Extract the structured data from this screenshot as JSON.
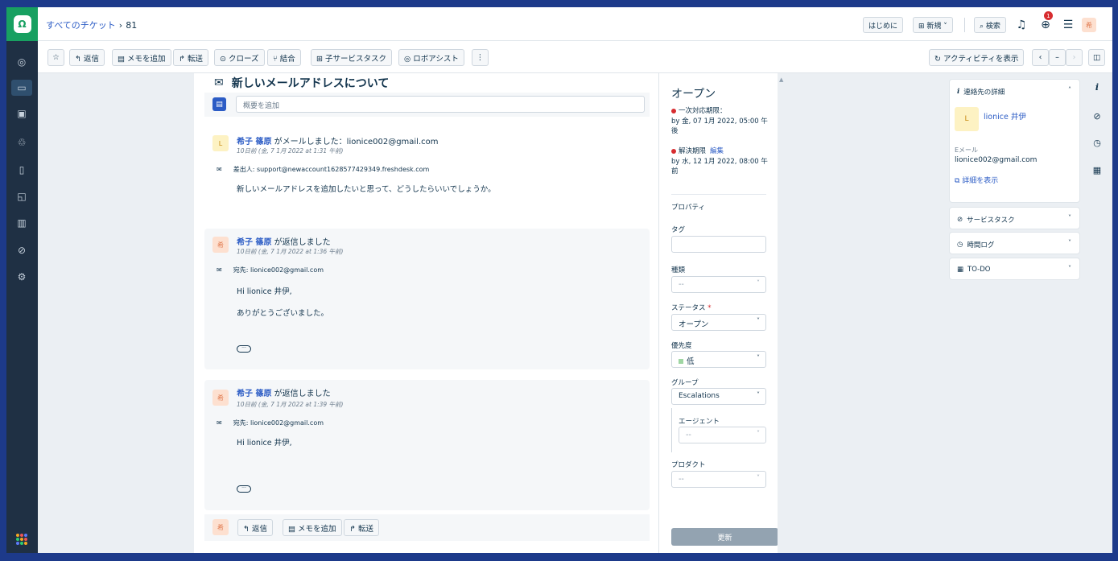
{
  "nav": {
    "logo": "Ω",
    "icons": [
      {
        "name": "dashboard-icon",
        "glyph": "◎"
      },
      {
        "name": "tickets-icon",
        "glyph": "▭"
      },
      {
        "name": "contacts-icon",
        "glyph": "▣"
      },
      {
        "name": "assets-icon",
        "glyph": "♲"
      },
      {
        "name": "knowledge-base-icon",
        "glyph": "▯"
      },
      {
        "name": "problems-icon",
        "glyph": "◱"
      },
      {
        "name": "reports-icon",
        "glyph": "▥"
      },
      {
        "name": "service-tasks-icon",
        "glyph": "⊘"
      },
      {
        "name": "settings-icon",
        "glyph": "⚙"
      }
    ]
  },
  "header": {
    "breadcrumb_link": "すべてのチケット",
    "breadcrumb_sep": "›",
    "ticket_id": "81",
    "getting_started": "はじめに",
    "new_button": "⊞ 新規 ˅",
    "search": "⌕ 検索",
    "notification_glyph": "♫",
    "gift_glyph": "⊕",
    "badge_count": "1",
    "headset_glyph": "☰",
    "avatar": "希"
  },
  "toolbar": {
    "star": "☆",
    "reply": "↰ 返信",
    "add_note": "▤ メモを追加",
    "forward": "↱ 転送",
    "close": "⊙ クローズ",
    "merge": "⑂ 結合",
    "child_task": "⊞ 子サービスタスク",
    "robo_assist": "◎ ロボアシスト",
    "more": "⋮",
    "show_activity": "↻ アクティビティを表示",
    "prev": "‹",
    "minus": "–",
    "next": "›",
    "panel_toggle": "◫"
  },
  "ticket": {
    "subject": "新しいメールアドレスについて",
    "summary_placeholder": "概要を追加"
  },
  "messages": [
    {
      "avatar": "L",
      "author": "希子 篠原",
      "action": " がメールしました：lionice002@gmail.com",
      "time": "10日前 (金, 7 1月 2022 at 1:31 午前)",
      "meta": "差出人: support@newaccount1628577429349.freshdesk.com",
      "body": "新しいメールアドレスを追加したいと思って、どうしたらいいでしょうか。"
    },
    {
      "avatar": "希",
      "author": "希子 篠原",
      "action": " が返信しました",
      "time": "10日前 (金, 7 1月 2022 at 1:36 午前)",
      "meta": "宛先: lionice002@gmail.com",
      "body": "Hi lionice 井伊,",
      "body2": "ありがとうございました。"
    },
    {
      "avatar": "希",
      "author": "希子 篠原",
      "action": " が返信しました",
      "time": "10日前 (金, 7 1月 2022 at 1:39 午前)",
      "meta": "宛先: lionice002@gmail.com",
      "body": "Hi lionice 井伊,"
    }
  ],
  "bottom": {
    "avatar": "希",
    "reply": "↰ 返信",
    "add_note": "▤ メモを追加",
    "forward": "↱ 転送"
  },
  "properties": {
    "status_title": "オープン",
    "first_response_label": "一次対応期限：",
    "first_response_value_1": "by 金, 07 1月 2022, 05:00 午",
    "first_response_value_2": "後",
    "resolution_label": "解決期限",
    "resolution_edit": "編集",
    "resolution_value_1": "by 水, 12 1月 2022, 08:00 午",
    "resolution_value_2": "前",
    "section": "プロパティ",
    "tag_label": "タグ",
    "type_label": "種類",
    "type_value": "--",
    "status_label": "ステータス",
    "required": " *",
    "status_value": "オープン",
    "priority_label": "優先度",
    "priority_value": "低",
    "group_label": "グループ",
    "group_value": "Escalations",
    "agent_label": "エージェント",
    "agent_value": "--",
    "product_label": "プロダクト",
    "product_value": "--",
    "update_button": "更新",
    "chevron": "˅"
  },
  "contact": {
    "title": "連絡先の詳細",
    "avatar": "L",
    "name": "lionice 井伊",
    "email_label": "Eメール",
    "email": "lionice002@gmail.com",
    "details_link": "詳細を表示"
  },
  "right_cards": {
    "service_tasks": "サービスタスク",
    "time_log": "時間ログ",
    "todo": "TO-DO"
  }
}
